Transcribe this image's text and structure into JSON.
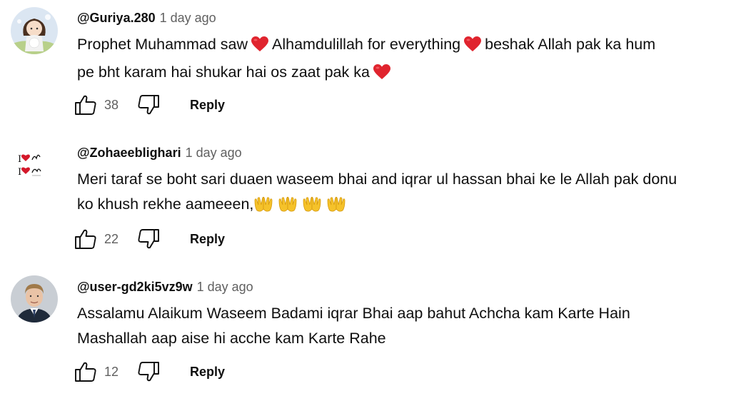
{
  "comments": [
    {
      "author": "@Guriya.280",
      "time": "1 day ago",
      "text_line1_parts": [
        "Prophet Muhammad saw",
        "Alhamdulillah for everything",
        "beshak Allah pak ka hum"
      ],
      "text_line2": "pe bht karam hai shukar hai os zaat pak ka",
      "likes": "38",
      "reply_label": "Reply",
      "avatar_icon": "girl-with-cat-avatar"
    },
    {
      "author": "@Zohaeeblighari",
      "time": "1 day ago",
      "text_line1": "Meri taraf se boht sari duaen waseem bhai and iqrar ul hassan bhai ke le Allah pak donu",
      "text_line2": "ko khush rekhe aameeen,",
      "likes": "22",
      "reply_label": "Reply",
      "avatar_icon": "i-love-allah-muhammad-avatar",
      "avatar_text": "I I"
    },
    {
      "author": "@user-gd2ki5vz9w",
      "time": "1 day ago",
      "text_line1": "Assalamu Alaikum Waseem Badami iqrar Bhai aap bahut Achcha kam Karte Hain",
      "text_line2": "Mashallah aap aise hi acche kam Karte Rahe",
      "likes": "12",
      "reply_label": "Reply",
      "avatar_icon": "man-in-suit-avatar"
    }
  ],
  "colors": {
    "text": "#0f0f0f",
    "secondary": "#606060",
    "heart": "#e0242e",
    "hands": "#f5c22a"
  },
  "icons": {
    "like": "thumbs-up-icon",
    "dislike": "thumbs-down-icon",
    "heart": "red-heart-emoji",
    "hands": "open-hands-emoji"
  }
}
